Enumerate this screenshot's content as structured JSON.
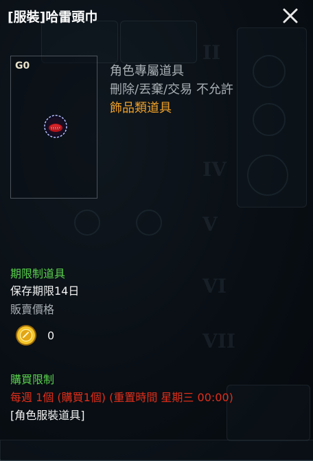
{
  "title": "[服裝]哈雷頭巾",
  "grade_label": "G0",
  "info": {
    "line1": "角色專屬道具",
    "line2": "刪除/丟棄/交易 不允許",
    "category": "飾品類道具"
  },
  "period": {
    "heading": "期限制道具",
    "storage": "保存期限14日",
    "sell_label": "販賣價格",
    "sell_value": "0"
  },
  "purchase": {
    "heading": "購買限制",
    "limit_text": "每週 1個 (購買1個) (重置時間 星期三 00:00)",
    "tag": "[角色服裝道具]"
  },
  "colors": {
    "heading_green": "#59d24c",
    "category_orange": "#f0a12a",
    "limit_red": "#e32e1a"
  },
  "icons": [
    "close-icon",
    "coin-icon",
    "bandana-item-icon"
  ]
}
